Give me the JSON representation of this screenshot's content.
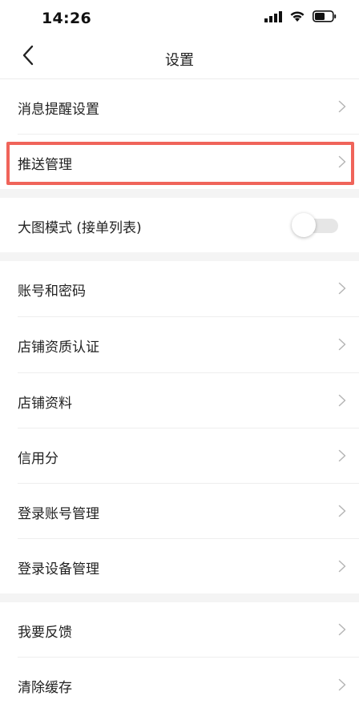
{
  "status_bar": {
    "time": "14:26",
    "icons": [
      "signal-icon",
      "wifi-icon",
      "battery-icon"
    ]
  },
  "nav": {
    "back_icon": "chevron-left-icon",
    "title": "设置"
  },
  "rows": {
    "message_reminder": {
      "label": "消息提醒设置"
    },
    "push_management": {
      "label": "推送管理"
    },
    "large_image_mode": {
      "label": "大图模式 (接单列表)",
      "toggle_on": false
    },
    "account_password": {
      "label": "账号和密码"
    },
    "store_qualification": {
      "label": "店铺资质认证"
    },
    "store_profile": {
      "label": "店铺资料"
    },
    "credit_score": {
      "label": "信用分"
    },
    "login_account_mgmt": {
      "label": "登录账号管理"
    },
    "login_device_mgmt": {
      "label": "登录设备管理"
    },
    "feedback": {
      "label": "我要反馈"
    },
    "clear_cache": {
      "label": "清除缓存"
    }
  },
  "colors": {
    "highlight": "#f0645a",
    "chevron": "#b5b5b5",
    "section_gap": "#f4f4f4"
  }
}
